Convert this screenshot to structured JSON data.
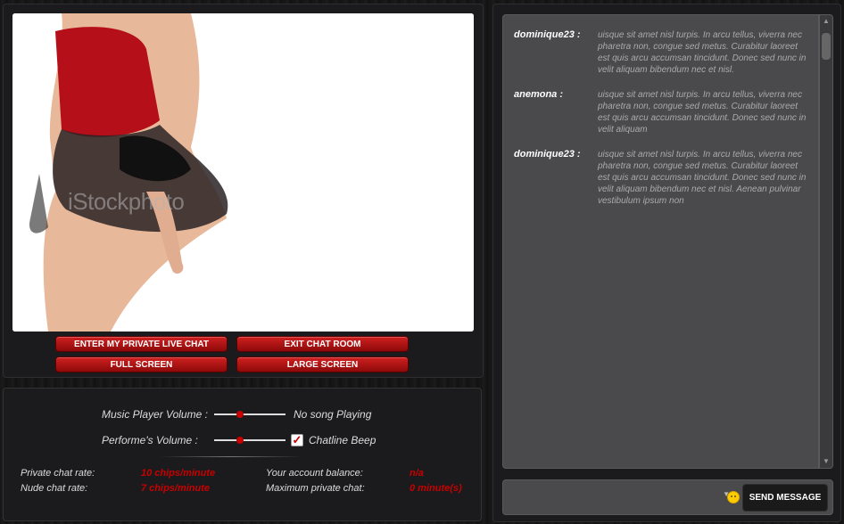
{
  "video": {
    "watermark": "iStockphoto",
    "buttons": {
      "enter_private": "ENTER MY PRIVATE LIVE CHAT",
      "exit_room": "EXIT CHAT ROOM",
      "full_screen": "FULL SCREEN",
      "large_screen": "LARGE SCREEN"
    }
  },
  "controls": {
    "music_volume_label": "Music Player Volume :",
    "music_volume_level": 0.35,
    "song_status": "No song Playing",
    "performer_volume_label": "Performe's Volume :",
    "performer_volume_level": 0.35,
    "chatline_beep_label": "Chatline Beep",
    "chatline_beep_checked": true,
    "private_rate_label": "Private chat rate:",
    "private_rate_value": "10 chips/minute",
    "nude_rate_label": "Nude chat rate:",
    "nude_rate_value": "7 chips/minute",
    "balance_label": "Your account balance:",
    "balance_value": "n/a",
    "max_private_label": "Maximum private chat:",
    "max_private_value": "0 minute(s)"
  },
  "chat": {
    "messages": [
      {
        "user": "dominique23 :",
        "text": "uisque sit amet nisl turpis. In arcu tellus, viverra nec pharetra non, congue sed metus. Curabitur laoreet est quis arcu accumsan tincidunt. Donec sed nunc in velit aliquam bibendum nec et nisl."
      },
      {
        "user": "anemona :",
        "text": "uisque sit amet nisl turpis. In arcu tellus, viverra nec pharetra non, congue sed metus. Curabitur laoreet est quis arcu accumsan tincidunt. Donec sed nunc in velit aliquam"
      },
      {
        "user": "dominique23 :",
        "text": "uisque sit amet nisl turpis. In arcu tellus, viverra nec pharetra non, congue sed metus. Curabitur laoreet est quis arcu accumsan tincidunt. Donec sed nunc in velit aliquam bibendum nec et nisl. Aenean pulvinar vestibulum ipsum non"
      }
    ],
    "send_label": "SEND MESSAGE",
    "emoji_icon": "smiley-icon"
  },
  "colors": {
    "accent_red": "#c80000",
    "button_red": "#d02020",
    "chat_bg": "#4a4a4c"
  }
}
